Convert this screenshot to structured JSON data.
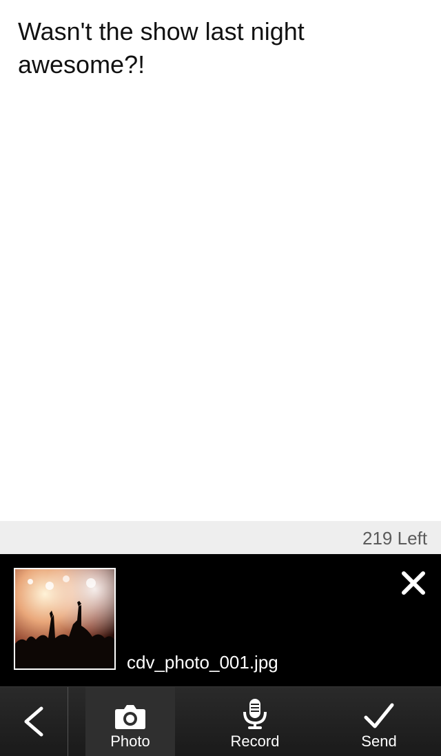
{
  "compose": {
    "message": "Wasn't the show last night\nawesome?!"
  },
  "counter": {
    "text": "219 Left"
  },
  "attachment": {
    "filename": "cdv_photo_001.jpg",
    "thumbnail_icon": "concert-photo-thumbnail",
    "remove_icon": "close-icon"
  },
  "toolbar": {
    "back_icon": "chevron-left-icon",
    "photo_label": "Photo",
    "photo_icon": "camera-icon",
    "record_label": "Record",
    "record_icon": "microphone-icon",
    "send_label": "Send",
    "send_icon": "checkmark-icon"
  },
  "colors": {
    "panel_bg": "#000000",
    "toolbar_bg": "#1f1f1f",
    "counter_bg": "#eeeeee",
    "counter_text": "#5b5b5b"
  }
}
